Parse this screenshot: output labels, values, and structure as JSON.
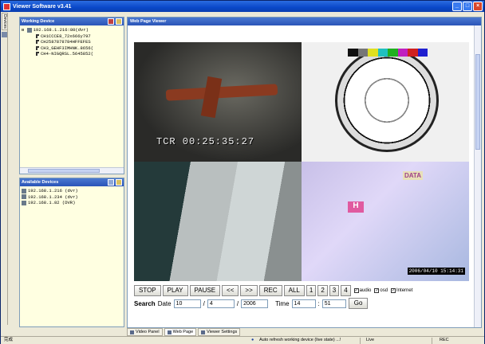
{
  "window": {
    "title": "Viewer Software v3.41",
    "brand_color": "#0a48c8"
  },
  "left_tabs": {
    "devices": "Devices"
  },
  "working_panel": {
    "title": "Working Device",
    "root": "192.168.1.216:80(dvr)",
    "channels": [
      "CH1CCCE8_72x666y797",
      "CH2587878784HFFEFES",
      "CH3_GEHF3IMHNK.8656(",
      "CH4-NIGQRSL.5645852("
    ]
  },
  "available_panel": {
    "title": "Available Devices",
    "devices": [
      "192.168.1.216 (dvr)",
      "192.168.1.234 (dvr)",
      "192.168.1.82 (DVR)"
    ]
  },
  "viewer": {
    "title": "Web Page Viewer",
    "cam1_overlay": "TCR 00:25:35:27",
    "cam4_stamp": "2006/04/10  15:14:31",
    "cam4_tag": "DATA",
    "cam4_tag2": "H"
  },
  "controls": {
    "stop": "STOP",
    "play": "PLAY",
    "pause": "PAUSE",
    "rew": "<<",
    "ff": ">>",
    "rec": "REC",
    "all": "ALL",
    "ch1": "1",
    "ch2": "2",
    "ch3": "3",
    "ch4": "4",
    "audio": "audio",
    "osd": "osd",
    "internet": "Internet"
  },
  "search": {
    "label": "Search",
    "date_label": "Date",
    "day": "10",
    "month": "4",
    "year": "2006",
    "time_label": "Time",
    "hour": "14",
    "minute": "51",
    "sep1": "/",
    "sep2": "/",
    "sep3": ":",
    "go": "Go"
  },
  "bottom_tabs": [
    "Video Panel",
    "Web Page",
    "Viewer Settings"
  ],
  "status": {
    "left": "完成",
    "message": "Auto refresh working device (live state) ...!",
    "mode": "Live",
    "rec": "REC"
  }
}
